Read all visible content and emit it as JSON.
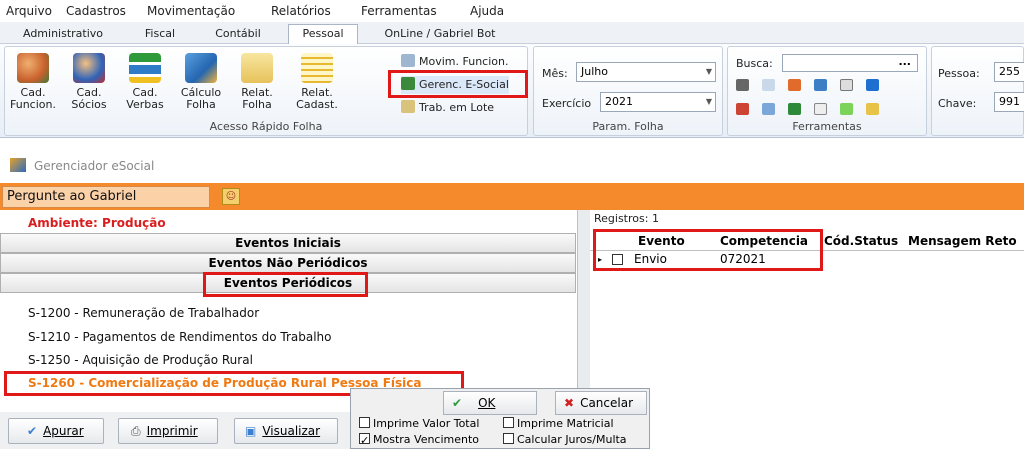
{
  "menu": [
    "Arquivo",
    "Cadastros",
    "Movimentação",
    "Relatórios",
    "Ferramentas",
    "Ajuda"
  ],
  "tabs": [
    {
      "label": "Administrativo",
      "active": false
    },
    {
      "label": "Fiscal",
      "active": false
    },
    {
      "label": "Contábil",
      "active": false
    },
    {
      "label": "Pessoal",
      "active": true
    },
    {
      "label": "OnLine / Gabriel Bot",
      "active": false
    }
  ],
  "ribbon": {
    "acesso": {
      "caption": "Acesso Rápido Folha",
      "buttons": [
        {
          "line1": "Cad.",
          "line2": "Funcion."
        },
        {
          "line1": "Cad.",
          "line2": "Sócios"
        },
        {
          "line1": "Cad.",
          "line2": "Verbas"
        },
        {
          "line1": "Cálculo",
          "line2": "Folha"
        },
        {
          "line1": "Relat.",
          "line2": "Folha"
        },
        {
          "line1": "Relat.",
          "line2": "Cadast."
        }
      ],
      "small": [
        "Movim. Funcion.",
        "Gerenc. E-Social",
        "Trab. em Lote"
      ]
    },
    "param": {
      "caption": "Param. Folha",
      "mes_label": "Mês:",
      "mes_value": "Julho",
      "exercicio_label": "Exercício",
      "exercicio_value": "2021"
    },
    "ferramentas": {
      "caption": "Ferramentas",
      "busca_label": "Busca:",
      "busca_dots": "..."
    },
    "pessoa": {
      "pessoa_label": "Pessoa:",
      "pessoa_value": "255",
      "chave_label": "Chave:",
      "chave_value": "991"
    }
  },
  "window": {
    "title": "Gerenciador eSocial",
    "ask": "Pergunte ao Gabriel"
  },
  "left": {
    "ambiente": "Ambiente: Produção",
    "headers": [
      "Eventos Iniciais",
      "Eventos Não Periódicos",
      "Eventos Periódicos"
    ],
    "items": [
      "S-1200 - Remuneração de Trabalhador",
      "S-1210 - Pagamentos de Rendimentos do Trabalho",
      "S-1250 - Aquisição de Produção Rural",
      "S-1260 - Comercialização de Produção Rural Pessoa Física"
    ]
  },
  "right": {
    "registros": "Registros: 1",
    "columns": [
      "Evento",
      "Competencia",
      "Cód.Status",
      "Mensagem Reto"
    ],
    "row": {
      "evento": "Envio",
      "competencia": "072021"
    }
  },
  "buttons": {
    "apurar": "Apurar",
    "imprimir": "Imprimir",
    "visualizar": "Visualizar"
  },
  "modal": {
    "ok": "OK",
    "cancelar": "Cancelar",
    "chk1": "Imprime Valor Total",
    "chk2": "Imprime Matricial",
    "chk3": "Mostra Vencimento",
    "chk4": "Calcular Juros/Multa"
  },
  "colors": {
    "orange": "#f58a2c",
    "highlight_red": "#e01818",
    "ambiente_red": "#d81e1e",
    "selected_item": "#f07a12"
  }
}
